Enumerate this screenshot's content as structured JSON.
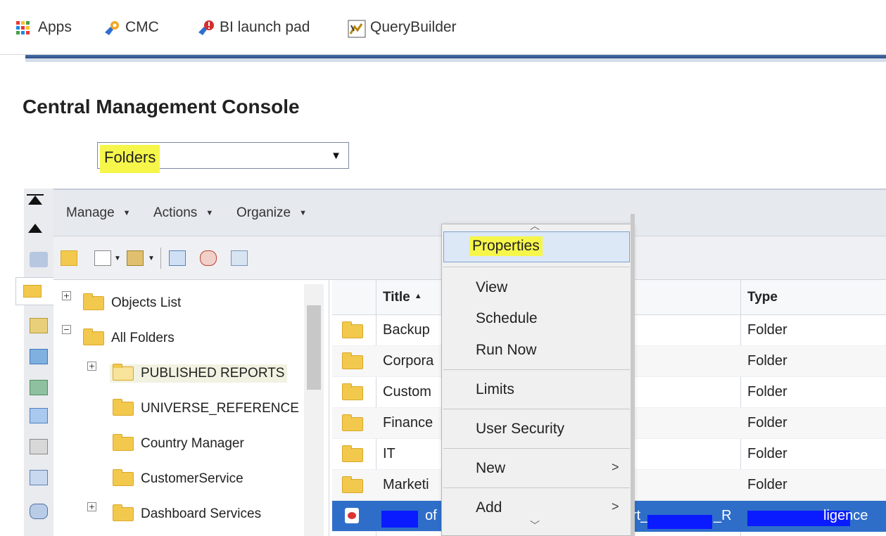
{
  "bookmarks": [
    {
      "label": "Apps",
      "icon": "apps-grid-icon"
    },
    {
      "label": "CMC",
      "icon": "cmc-icon"
    },
    {
      "label": "BI launch pad",
      "icon": "bi-launchpad-icon"
    },
    {
      "label": "QueryBuilder",
      "icon": "querybuilder-icon"
    }
  ],
  "page_title": "Central Management Console",
  "area_select": {
    "value": "Folders"
  },
  "menubar": {
    "manage": "Manage",
    "actions": "Actions",
    "organize": "Organize"
  },
  "tree": {
    "items": [
      {
        "label": "Objects List"
      },
      {
        "label": "All Folders"
      },
      {
        "label": "PUBLISHED REPORTS"
      },
      {
        "label": "UNIVERSE_REFERENCE"
      },
      {
        "label": "Country Manager"
      },
      {
        "label": "CustomerService"
      },
      {
        "label": "Dashboard Services"
      }
    ]
  },
  "list": {
    "headers": {
      "title": "Title",
      "type": "Type"
    },
    "rows": [
      {
        "title": "Backup",
        "type": "Folder"
      },
      {
        "title": "Corpora",
        "type": "Folder"
      },
      {
        "title": "Custom",
        "type": "Folder"
      },
      {
        "title": "Finance",
        "type": "Folder"
      },
      {
        "title": "IT",
        "type": "Folder"
      },
      {
        "title": "Marketi",
        "type": "Folder"
      },
      {
        "title": "of",
        "title_tail": "rt_",
        "title_tail2": "_R",
        "type": "ligence"
      }
    ]
  },
  "context_menu": {
    "properties": "Properties",
    "view": "View",
    "schedule": "Schedule",
    "run_now": "Run Now",
    "limits": "Limits",
    "user_security": "User Security",
    "new": "New",
    "add": "Add",
    "submenu_arrow": ">"
  },
  "colors": {
    "highlight": "#f6f64a",
    "selection": "#2e6ec9",
    "redaction": "#0a1cff"
  }
}
